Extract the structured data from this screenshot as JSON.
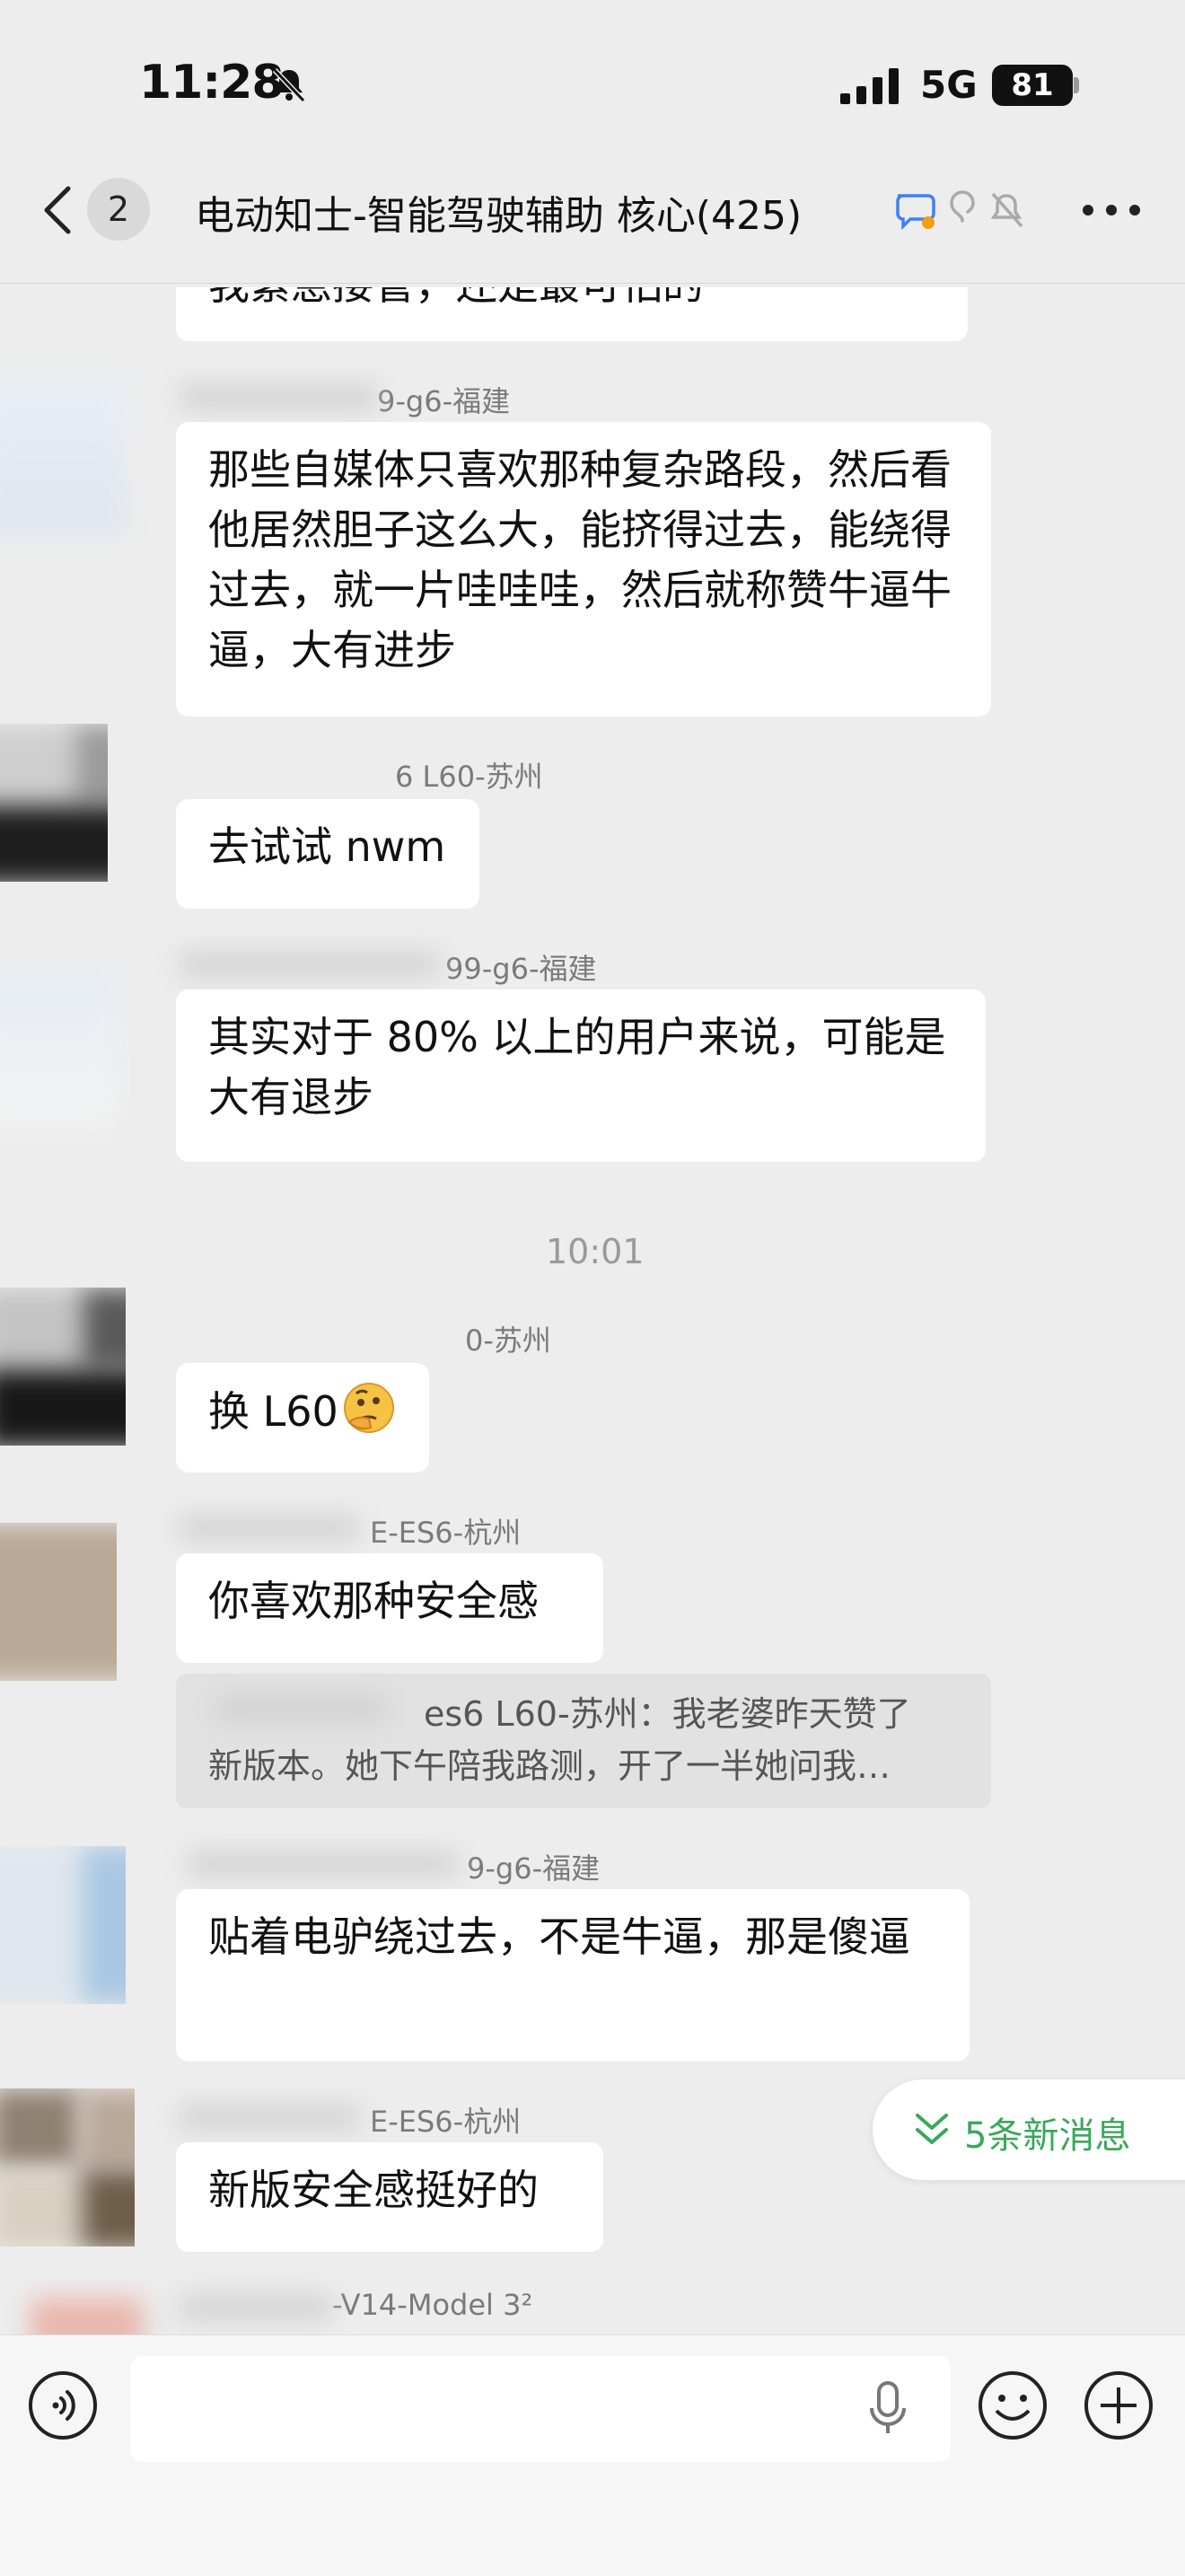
{
  "status_bar": {
    "time": "11:28",
    "network": "5G",
    "battery": "81"
  },
  "nav": {
    "back_count": "2",
    "title": "电动知士-智能驾驶辅助 核心(425)"
  },
  "messages": [
    {
      "partial_text": "我紧急接管，还是最可怕的"
    },
    {
      "sender": "9-g6-福建",
      "text": "那些自媒体只喜欢那种复杂路段，然后看他居然胆子这么大，能挤得过去，能绕得过去，就一片哇哇哇，然后就称赞牛逼牛逼，大有进步"
    },
    {
      "sender": "6 L60-苏州",
      "text": "去试试 nwm"
    },
    {
      "sender": "99-g6-福建",
      "text": "其实对于 80% 以上的用户来说，可能是大有退步"
    },
    {
      "sender": "0-苏州",
      "text": "换 L60",
      "emoji": "thinking-face"
    },
    {
      "sender": "E-ES6-杭州",
      "text": "你喜欢那种安全感"
    },
    {
      "sender": "9-g6-福建",
      "text": "贴着电驴绕过去，不是牛逼，那是傻逼"
    },
    {
      "sender": "E-ES6-杭州",
      "text": "新版安全感挺好的"
    },
    {
      "sender": "-V14-Model 3²"
    }
  ],
  "time_separator": "10:01",
  "quote": {
    "text_line1": "es6 L60-苏州：我老婆昨天赞了",
    "text_line2": "新版本。她下午陪我路测，开了一半她问我…"
  },
  "new_messages": {
    "label": "5条新消息"
  },
  "colors": {
    "background": "#ededed",
    "bubble": "#ffffff",
    "accent_green": "#3aa85a"
  },
  "icons": [
    "bell-slash-icon",
    "signal-icon",
    "back-chevron-icon",
    "group-chat-icon",
    "ear-icon",
    "mute-bell-icon",
    "more-icon",
    "chevron-double-down-icon",
    "voice-icon",
    "mic-icon",
    "emoji-icon",
    "plus-icon"
  ]
}
